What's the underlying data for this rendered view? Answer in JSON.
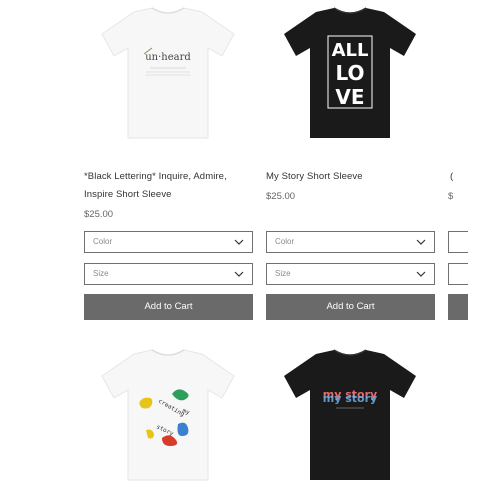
{
  "products": [
    {
      "title": "*Black Lettering* Inquire, Admire, Inspire Short Sleeve",
      "price": "$25.00",
      "color_placeholder": "Color",
      "size_placeholder": "Size",
      "add_to_cart": "Add to Cart",
      "shirt_color": "#ffffff",
      "print_text": "un·heard"
    },
    {
      "title": "My Story Short Sleeve",
      "price": "$25.00",
      "color_placeholder": "Color",
      "size_placeholder": "Size",
      "add_to_cart": "Add to Cart",
      "shirt_color": "#1a1a1a",
      "print_lines": [
        "ALL",
        "LO",
        "VE"
      ]
    },
    {
      "shirt_color": "#ffffff",
      "print_lines": [
        "creating",
        "my",
        "story"
      ]
    },
    {
      "shirt_color": "#1a1a1a",
      "print_lines": [
        "my story",
        "my story"
      ]
    }
  ],
  "partial_column": {
    "title_fragment": "(",
    "price_fragment": "$"
  },
  "colors": {
    "button_bg": "#6a6a6a",
    "border": "#707070",
    "text": "#333333"
  }
}
